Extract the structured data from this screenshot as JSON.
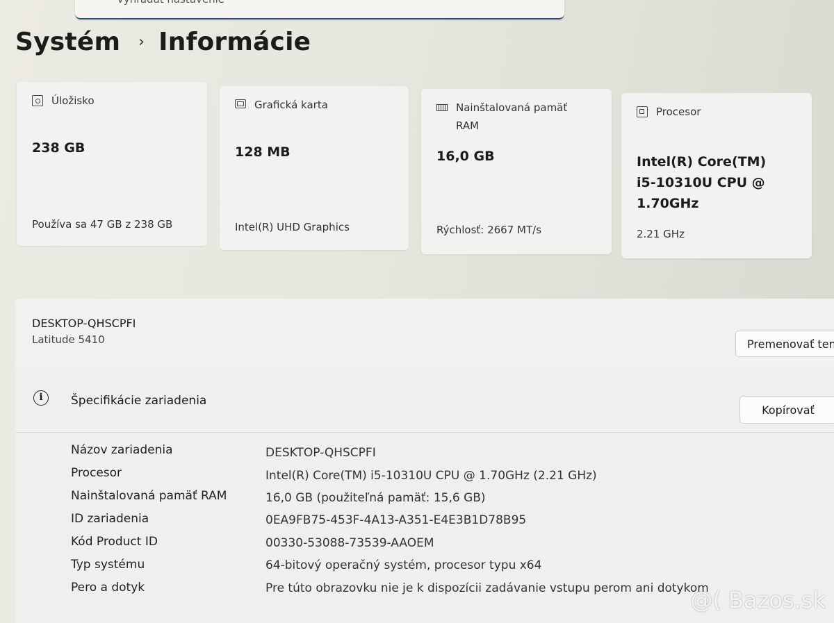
{
  "search": {
    "placeholder": "Vyhľadať nastavenie"
  },
  "breadcrumb": {
    "parent": "Systém",
    "separator": "›",
    "current": "Informácie"
  },
  "cards": [
    {
      "id": "storage",
      "icon": "storage-icon",
      "label": "Úložisko",
      "value": "238 GB",
      "detail": "Používa sa 47 GB z 238 GB"
    },
    {
      "id": "gpu",
      "icon": "graphics-card-icon",
      "label": "Grafická karta",
      "value": "128 MB",
      "detail": "Intel(R) UHD Graphics"
    },
    {
      "id": "ram",
      "icon": "memory-icon",
      "label": "Nainštalovaná pamäť RAM",
      "value": "16,0 GB",
      "detail": "Rýchlosť: 2667 MT/s"
    },
    {
      "id": "cpu",
      "icon": "processor-icon",
      "label": "Procesor",
      "value": "Intel(R) Core(TM) i5-10310U CPU @ 1.70GHz",
      "detail": "2.21 GHz"
    }
  ],
  "device": {
    "name": "DESKTOP-QHSCPFI",
    "model": "Latitude 5410",
    "rename_button": "Premenovať tento počítač"
  },
  "specs": {
    "title": "Špecifikácie zariadenia",
    "copy_button": "Kopírovať",
    "rows": [
      {
        "key": "Názov zariadenia",
        "value": "DESKTOP-QHSCPFI"
      },
      {
        "key": "Procesor",
        "value": "Intel(R) Core(TM) i5-10310U CPU @ 1.70GHz (2.21 GHz)"
      },
      {
        "key": "Nainštalovaná pamäť RAM",
        "value": "16,0 GB (použiteľná pamäť: 15,6 GB)"
      },
      {
        "key": "ID zariadenia",
        "value": "0EA9FB75-453F-4A13-A351-E4E3B1D78B95"
      },
      {
        "key": "Kód Product ID",
        "value": "00330-53088-73539-AAOEM"
      },
      {
        "key": "Typ systému",
        "value": "64-bitový operačný systém, procesor typu x64"
      },
      {
        "key": "Pero a dotyk",
        "value": "Pre túto obrazovku nie je k dispozícii zadávanie vstupu perom ani dotykom"
      }
    ]
  },
  "watermark": "@( Bazos.sk"
}
